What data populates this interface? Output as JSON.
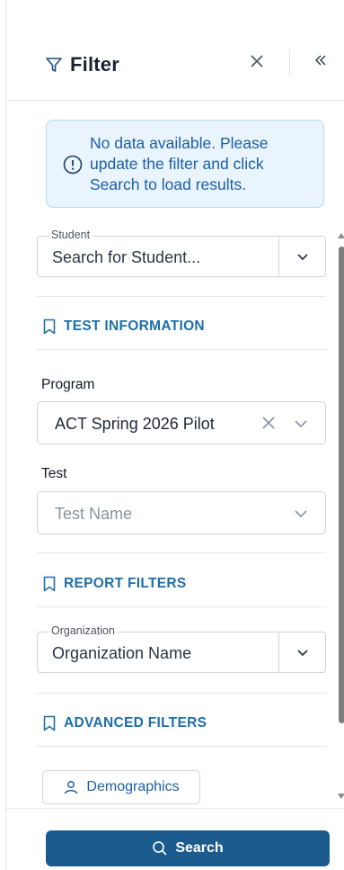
{
  "header": {
    "title": "Filter"
  },
  "alert": {
    "message": "No data available. Please update the filter and click Search to load results."
  },
  "student": {
    "label": "Student",
    "placeholder": "Search for Student..."
  },
  "sections": {
    "test_information": "TEST INFORMATION",
    "report_filters": "REPORT FILTERS",
    "advanced_filters": "ADVANCED FILTERS"
  },
  "program": {
    "label": "Program",
    "value": "ACT Spring 2026 Pilot"
  },
  "test": {
    "label": "Test",
    "placeholder": "Test Name"
  },
  "organization": {
    "label": "Organization",
    "placeholder": "Organization Name"
  },
  "demographics": {
    "label": "Demographics"
  },
  "footer": {
    "search_label": "Search"
  },
  "colors": {
    "accent": "#1e6fa8",
    "button": "#1c5b8e",
    "alert_bg": "#eaf4fc",
    "alert_text": "#1c5fa8"
  },
  "icons": {
    "title": "filter-funnel-icon",
    "close": "close-icon",
    "collapse": "double-chevron-left-icon",
    "info": "info-circle-icon",
    "section": "bookmark-icon",
    "dropdown": "chevron-down-icon",
    "clear": "clear-x-icon",
    "person": "person-icon",
    "search": "search-icon"
  }
}
